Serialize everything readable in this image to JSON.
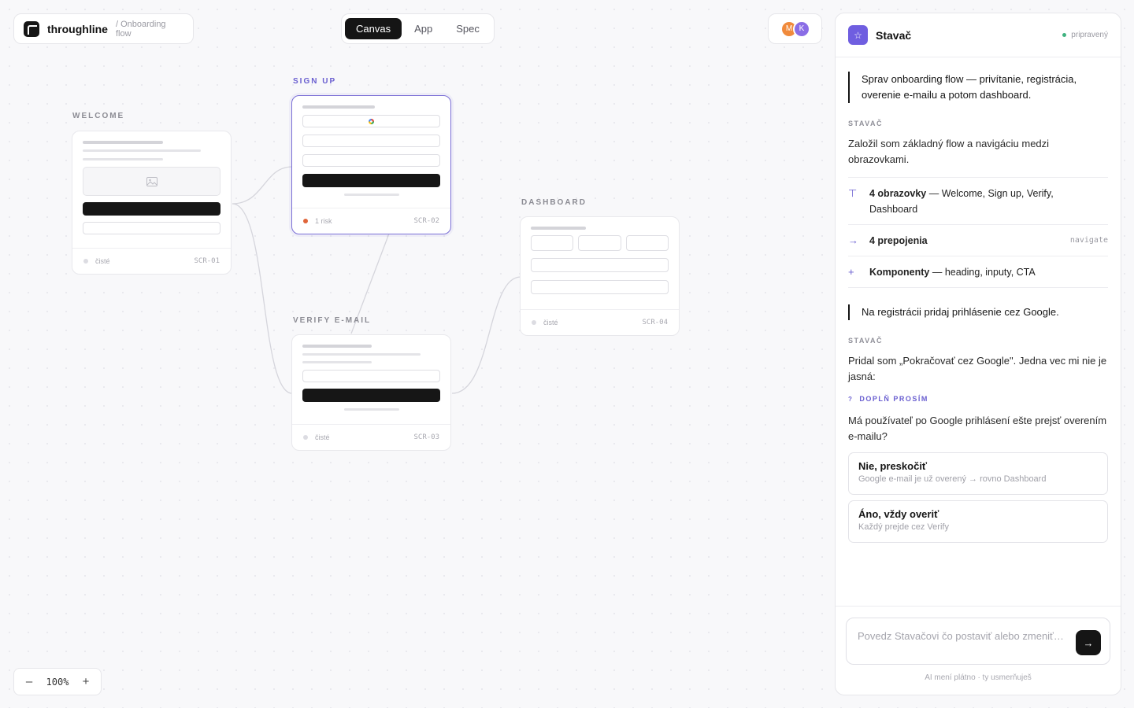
{
  "app": {
    "name": "throughline",
    "project": "/ Onboarding flow"
  },
  "view_tabs": [
    {
      "label": "Canvas",
      "active": true
    },
    {
      "label": "App",
      "active": false
    },
    {
      "label": "Spec",
      "active": false
    }
  ],
  "collaborators": [
    {
      "initial": "M",
      "color": "#f08a3c"
    },
    {
      "initial": "K",
      "color": "#8a6de6"
    }
  ],
  "screens": {
    "welcome": {
      "label": "WELCOME",
      "status": "čisté",
      "id": "SCR-01"
    },
    "signup": {
      "label": "SIGN UP",
      "status": "1 risk",
      "id": "SCR-02"
    },
    "verify": {
      "label": "VERIFY E-MAIL",
      "status": "čisté",
      "id": "SCR-03"
    },
    "dashboard": {
      "label": "DASHBOARD",
      "status": "čisté",
      "id": "SCR-04"
    }
  },
  "zoom": {
    "minus": "–",
    "level": "100%",
    "plus": "+"
  },
  "assistant": {
    "icon": "star-icon",
    "title": "Stavač",
    "status": "pripravený",
    "user_msg_1": "Sprav onboarding flow — privítanie, registrácia, overenie e-mailu a potom dashboard.",
    "label_1": "STAVAČ",
    "reply_1": "Založil som základný flow a navigáciu medzi obrazovkami.",
    "changes": [
      {
        "icon": "⊤",
        "bold": "4 obrazovky",
        "text": " — Welcome, Sign up, Verify, Dashboard",
        "tag": ""
      },
      {
        "icon": "→",
        "bold": "4 prepojenia",
        "text": "",
        "tag": "navigate"
      },
      {
        "icon": "+",
        "bold": "Komponenty",
        "text": " — heading, inputy, CTA",
        "tag": ""
      }
    ],
    "user_msg_2": "Na registrácii pridaj prihlásenie cez Google.",
    "label_2": "STAVAČ",
    "reply_2": "Pridal som „Pokračovať cez Google\". Jedna vec mi nie je jasná:",
    "ask_icon": "?",
    "ask_label": "DOPLŇ PROSÍM",
    "question": "Má používateľ po Google prihlásení ešte prejsť overením e-mailu?",
    "options": [
      {
        "title": "Nie, preskočiť",
        "subtitle": "Google e-mail je už overený → rovno Dashboard"
      },
      {
        "title": "Áno, vždy overiť",
        "subtitle": "Každý prejde cez Verify"
      }
    ],
    "composer_placeholder": "Povedz Stavačovi čo postaviť alebo zmeniť…",
    "send_icon": "→",
    "footnote": "AI mení plátno · ty usmerňuješ"
  },
  "colors": {
    "accent": "#6f5ee0",
    "risk": "#e0653a",
    "ready": "#3fb27f"
  }
}
